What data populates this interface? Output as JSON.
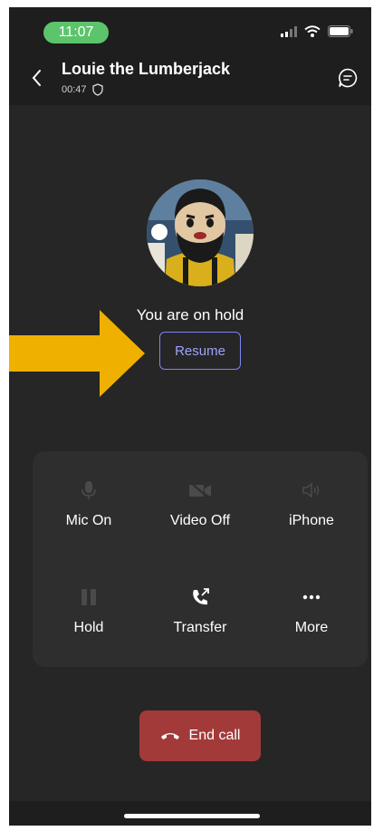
{
  "status_bar": {
    "time": "11:07"
  },
  "header": {
    "caller_name": "Louie the Lumberjack",
    "call_timer": "00:47"
  },
  "hold": {
    "message": "You are on hold",
    "resume_label": "Resume"
  },
  "controls": [
    {
      "label": "Mic On",
      "icon": "microphone-icon",
      "enabled": false
    },
    {
      "label": "Video Off",
      "icon": "video-off-icon",
      "enabled": false
    },
    {
      "label": "iPhone",
      "icon": "speaker-icon",
      "enabled": false
    },
    {
      "label": "Hold",
      "icon": "pause-icon",
      "enabled": false
    },
    {
      "label": "Transfer",
      "icon": "phone-transfer-icon",
      "enabled": true
    },
    {
      "label": "More",
      "icon": "more-icon",
      "enabled": true
    }
  ],
  "end_call_label": "End call",
  "colors": {
    "accent": "#7f85f5",
    "end_call": "#a33a3a",
    "annotation_arrow": "#f0b000",
    "status_pill": "#5cc46b"
  }
}
